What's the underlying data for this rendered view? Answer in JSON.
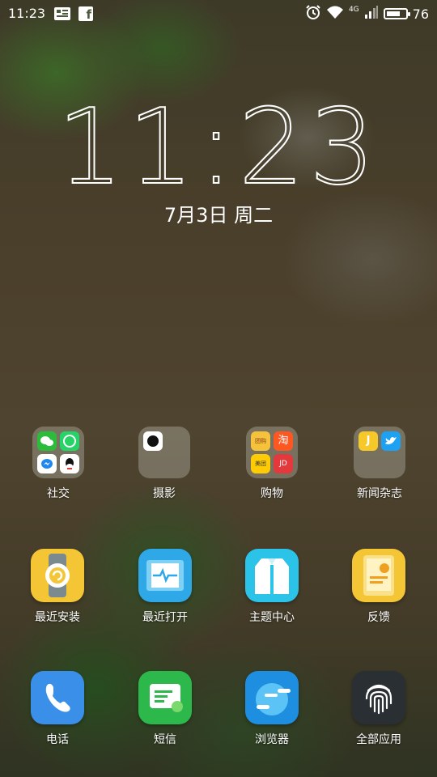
{
  "status_bar": {
    "time": "11:23",
    "network": "4G",
    "battery_level": "76",
    "battery_fraction": 0.76,
    "icons": [
      "news-icon",
      "facebook-icon",
      "alarm-icon",
      "wifi-icon",
      "mobile-data-icon",
      "signal-icon",
      "battery-icon"
    ]
  },
  "lockscreen": {
    "clock_hours": "11",
    "clock_minutes": "23",
    "date": "7月3日 周二"
  },
  "folders": [
    {
      "label": "社交",
      "apps": [
        "wechat-icon",
        "whatsapp-icon",
        "messenger-icon",
        "qq-icon"
      ]
    },
    {
      "label": "摄影",
      "apps": [
        "camera-icon"
      ]
    },
    {
      "label": "购物",
      "apps": [
        "tuan-icon",
        "taobao-icon",
        "meituan-icon",
        "jingdong-icon"
      ],
      "mini_text": [
        "团购",
        "淘",
        "美团",
        "JD"
      ]
    },
    {
      "label": "新闻杂志",
      "apps": [
        "j-news-icon",
        "twitter-icon"
      ],
      "mini_text": [
        "J"
      ]
    }
  ],
  "apps_row": [
    {
      "label": "最近安装",
      "icon": "watch-icon",
      "color": "#F4C534"
    },
    {
      "label": "最近打开",
      "icon": "pulse-tablet-icon",
      "color": "#2EA8E6"
    },
    {
      "label": "主题中心",
      "icon": "shirt-icon",
      "color": "#2BC4E8"
    },
    {
      "label": "反馈",
      "icon": "feedback-icon",
      "color": "#F4C534"
    }
  ],
  "dock": [
    {
      "label": "电话",
      "icon": "phone-icon",
      "color": "#3A8FE8"
    },
    {
      "label": "短信",
      "icon": "message-icon",
      "color": "#2DB84C"
    },
    {
      "label": "浏览器",
      "icon": "browser-icon",
      "color": "#1E8FE0"
    },
    {
      "label": "全部应用",
      "icon": "fingerprint-icon",
      "color": "#2A2F33"
    }
  ]
}
